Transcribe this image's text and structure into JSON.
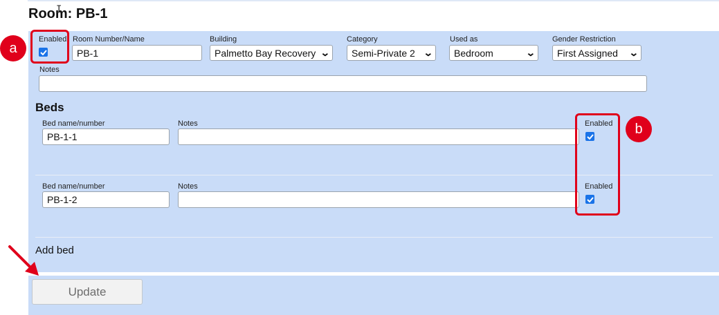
{
  "room": {
    "title": "Room: PB-1"
  },
  "fields": {
    "enabled_label": "Enabled",
    "room_label": "Room Number/Name",
    "room_value": "PB-1",
    "building_label": "Building",
    "building_value": "Palmetto Bay Recovery",
    "category_label": "Category",
    "category_value": "Semi-Private 2",
    "used_as_label": "Used as",
    "used_as_value": "Bedroom",
    "gender_label": "Gender Restriction",
    "gender_value": "First Assigned",
    "notes_label": "Notes",
    "notes_value": ""
  },
  "beds": {
    "heading": "Beds",
    "items": [
      {
        "name_label": "Bed name/number",
        "name_value": "PB-1-1",
        "notes_label": "Notes",
        "notes_value": "",
        "enabled_label": "Enabled",
        "enabled": true
      },
      {
        "name_label": "Bed name/number",
        "name_value": "PB-1-2",
        "notes_label": "Notes",
        "notes_value": "",
        "enabled_label": "Enabled",
        "enabled": true
      }
    ],
    "add_label": "Add bed"
  },
  "actions": {
    "update_label": "Update"
  },
  "annotations": {
    "badge_a": "a",
    "badge_b": "b",
    "color": "#e0001b"
  },
  "colors": {
    "panel": "#c9dcf8",
    "checkbox": "#1a73e8"
  }
}
